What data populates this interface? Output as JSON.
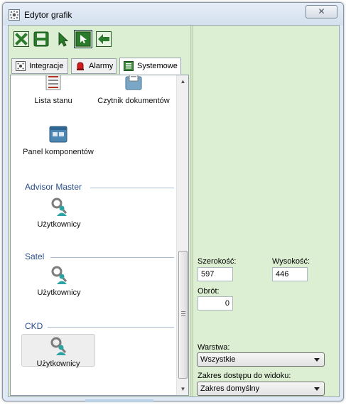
{
  "window": {
    "title": "Edytor grafik",
    "close_label": "✕"
  },
  "toolbar": {
    "buttons": [
      {
        "name": "delete-button",
        "icon": "close-x-icon"
      },
      {
        "name": "save-button",
        "icon": "floppy-disk-icon"
      },
      {
        "name": "pointer-button",
        "icon": "pointer-icon"
      },
      {
        "name": "select-mode-button",
        "icon": "select-arrow-icon",
        "active": true
      },
      {
        "name": "back-button",
        "icon": "arrow-left-icon"
      }
    ],
    "accent": "#2c7a2c"
  },
  "tabs": [
    {
      "label": "Integracje",
      "icon": "integration-icon"
    },
    {
      "label": "Alarmy",
      "icon": "bell-icon"
    },
    {
      "label": "Systemowe",
      "icon": "system-icon",
      "selected": true
    }
  ],
  "panel": {
    "items_top": [
      {
        "label": "Lista stanu",
        "icon": "list-icon"
      },
      {
        "label": "Czytnik dokumentów",
        "icon": "document-reader-icon"
      },
      {
        "label": "Panel komponentów",
        "icon": "component-panel-icon"
      }
    ],
    "groups": [
      {
        "title": "Advisor Master",
        "item_label": "Użytkownicy"
      },
      {
        "title": "Satel",
        "item_label": "Użytkownicy"
      },
      {
        "title": "CKD",
        "item_label": "Użytkownicy",
        "selected": true
      }
    ]
  },
  "props": {
    "width_label": "Szerokość:",
    "width_value": "597",
    "height_label": "Wysokość:",
    "height_value": "446",
    "rotation_label": "Obrót:",
    "rotation_value": "0",
    "layer_label": "Warstwa:",
    "layer_value": "Wszystkie",
    "access_label": "Zakres dostępu do widoku:",
    "access_value": "Zakres domyślny"
  },
  "colors": {
    "client_bg": "#dcefd2",
    "group_title": "#2a4d8a"
  }
}
